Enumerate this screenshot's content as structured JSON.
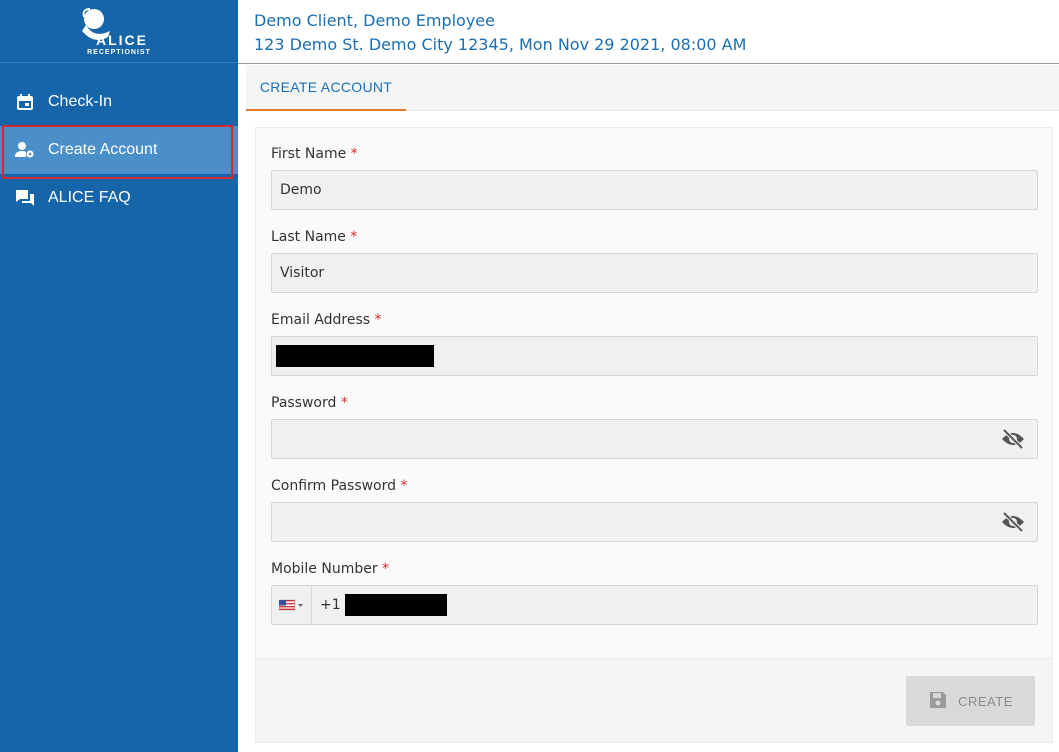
{
  "header": {
    "line1": "Demo Client, Demo Employee",
    "line2": "123 Demo St. Demo City 12345, Mon Nov 29 2021, 08:00 AM"
  },
  "logo": {
    "text": "ALICE RECEPTIONIST"
  },
  "sidebar": {
    "items": [
      {
        "label": "Check-In",
        "icon": "calendar-icon"
      },
      {
        "label": "Create Account",
        "icon": "user-gear-icon",
        "active": true
      },
      {
        "label": "ALICE FAQ",
        "icon": "chat-icon"
      }
    ]
  },
  "tabs": [
    {
      "label": "CREATE ACCOUNT",
      "active": true
    }
  ],
  "form": {
    "first_name": {
      "label": "First Name",
      "value": "Demo"
    },
    "last_name": {
      "label": "Last Name",
      "value": "Visitor"
    },
    "email": {
      "label": "Email Address",
      "value": ""
    },
    "password": {
      "label": "Password",
      "value": ""
    },
    "confirm_password": {
      "label": "Confirm Password",
      "value": ""
    },
    "mobile": {
      "label": "Mobile Number",
      "prefix": "+1",
      "value": ""
    },
    "required_mark": "*"
  },
  "actions": {
    "create_label": "CREATE"
  },
  "colors": {
    "sidebar_bg": "#1565a8",
    "accent_blue": "#1a6fb5",
    "tab_underline": "#e57a2b",
    "required": "#d32f2f"
  }
}
